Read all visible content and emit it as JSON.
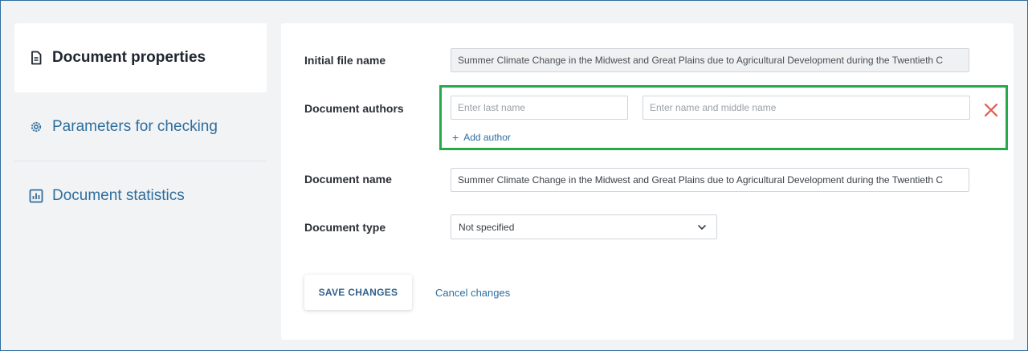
{
  "sidebar": {
    "items": [
      {
        "label": "Document properties",
        "icon": "document-icon",
        "active": true
      },
      {
        "label": "Parameters for checking",
        "icon": "gear-icon",
        "active": false
      },
      {
        "label": "Document statistics",
        "icon": "bar-chart-icon",
        "active": false
      }
    ]
  },
  "form": {
    "initial_file_name": {
      "label": "Initial file name",
      "value": "Summer Climate Change in the Midwest and Great Plains due to Agricultural Development during the Twentieth C"
    },
    "authors": {
      "label": "Document authors",
      "last_name_placeholder": "Enter last name",
      "first_name_placeholder": "Enter name and middle name",
      "add_author_label": "Add author"
    },
    "document_name": {
      "label": "Document name",
      "value": "Summer Climate Change in the Midwest and Great Plains due to Agricultural Development during the Twentieth C"
    },
    "document_type": {
      "label": "Document type",
      "selected": "Not specified"
    },
    "save_label": "SAVE CHANGES",
    "cancel_label": "Cancel changes"
  },
  "colors": {
    "accent": "#2f6e9e",
    "highlight": "#27a84a",
    "remove": "#e05a4f"
  }
}
